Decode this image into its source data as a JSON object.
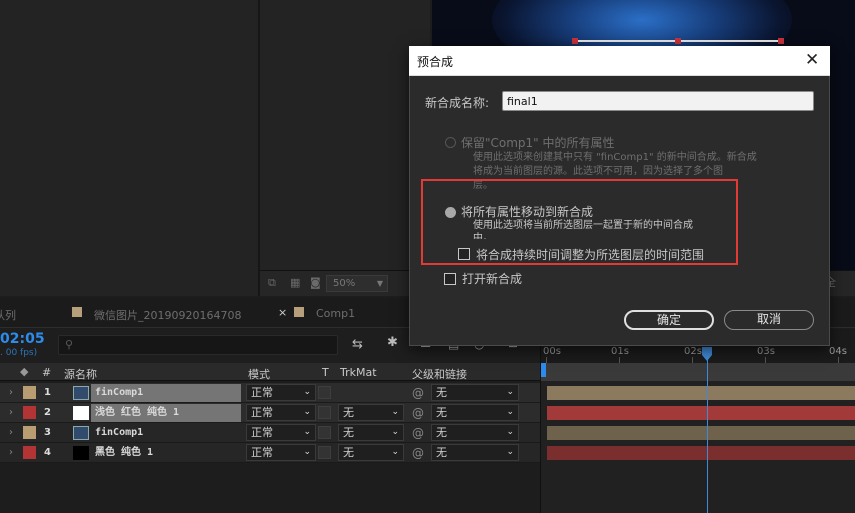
{
  "viewer_bar": {
    "zoom": "50%",
    "right_text": "全"
  },
  "tabs": [
    {
      "label": "队列"
    },
    {
      "label": "微信图片_20190920164708"
    },
    {
      "label": "Comp1"
    }
  ],
  "timeline": {
    "timecode": "02:05",
    "fps": ". 00 fps)",
    "search_placeholder": "",
    "ruler": [
      "00s",
      "01s",
      "02s",
      "03s",
      "04s"
    ],
    "columns": {
      "source_name": "源名称",
      "mode": "模式",
      "t": "T",
      "trkmat": "TrkMat",
      "parent": "父级和链接",
      "hash": "#"
    },
    "layers": [
      {
        "num": "1",
        "name": "finComp1",
        "mode": "正常",
        "trkmat": "",
        "parent": "无",
        "label_color": "#b89d72",
        "thumb": "comp"
      },
      {
        "num": "2",
        "name": "浅色 红色 纯色 1",
        "mode": "正常",
        "trkmat": "无",
        "parent": "无",
        "label_color": "#b33434",
        "thumb": "white"
      },
      {
        "num": "3",
        "name": "finComp1",
        "mode": "正常",
        "trkmat": "无",
        "parent": "无",
        "label_color": "#b89d72",
        "thumb": "comp"
      },
      {
        "num": "4",
        "name": "黑色 纯色 1",
        "mode": "正常",
        "trkmat": "无",
        "parent": "无",
        "label_color": "#b33434",
        "thumb": "black"
      }
    ]
  },
  "dialog": {
    "title": "预合成",
    "name_label": "新合成名称:",
    "name_value": "final1",
    "option1_title": "保留\"Comp1\" 中的所有属性",
    "option1_desc_1": "使用此选项来创建其中只有 \"finComp1\" 的新中间合成。新合成",
    "option1_desc_2": "将成为当前图层的源。此选项不可用，因为选择了多个图",
    "option1_desc_3": "层。",
    "option2_title": "将所有属性移动到新合成",
    "option2_desc_1": "使用此选项将当前所选图层一起置于新的中间合成",
    "option2_desc_2": "中。",
    "adjust_duration": "将合成持续时间调整为所选图层的时间范围",
    "open_new": "打开新合成",
    "ok": "确定",
    "cancel": "取消"
  },
  "colors": {
    "accent_blue": "#2d8ceb",
    "highlight_red": "#e23a35",
    "sand_track": "#8c7a5e",
    "red_track": "#a23a3a"
  }
}
